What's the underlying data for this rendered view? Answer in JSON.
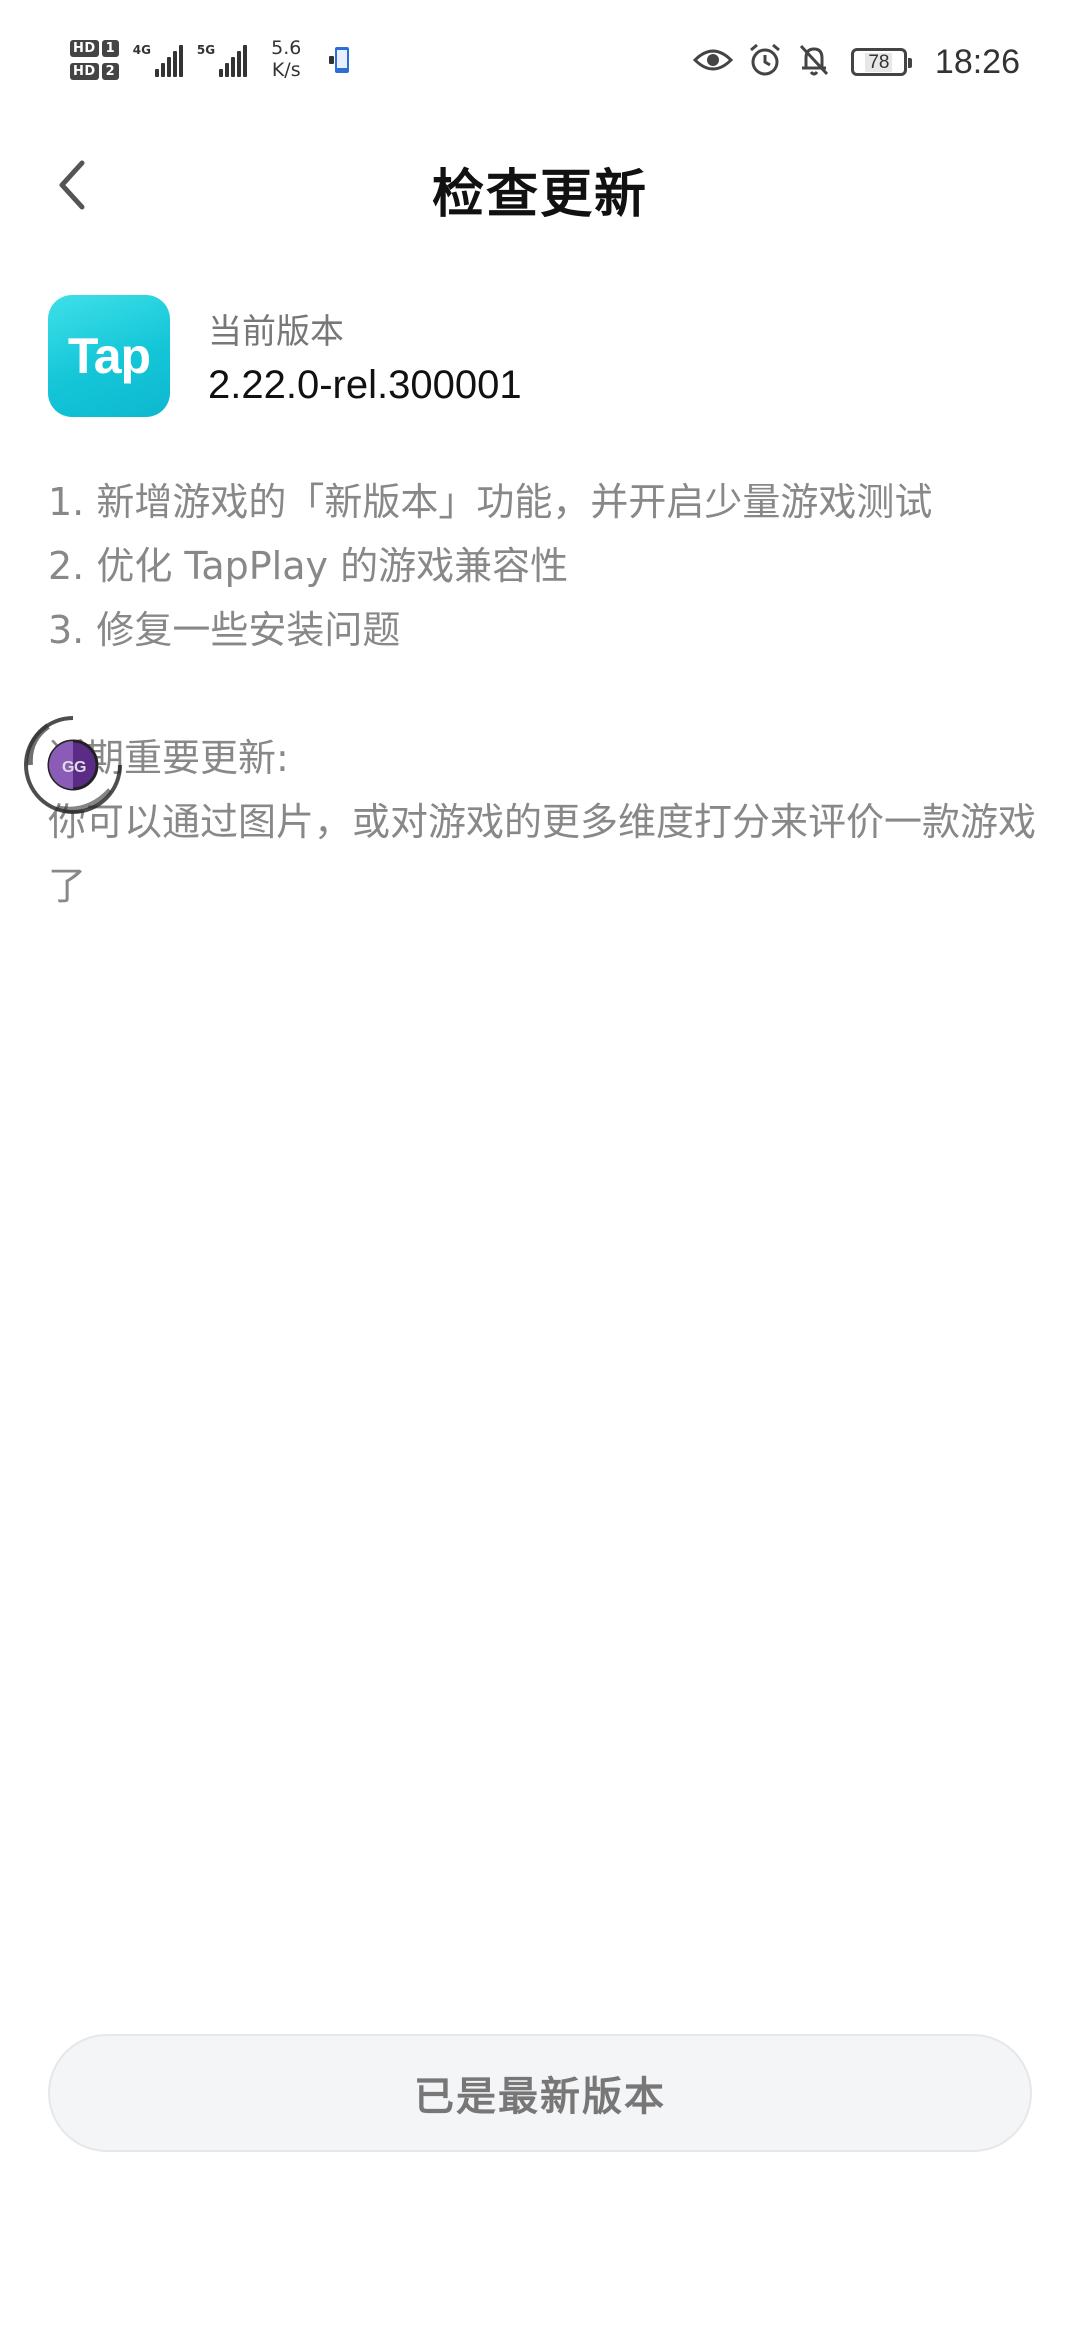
{
  "status_bar": {
    "hd1": "HD",
    "hd1_num": "1",
    "hd2": "HD",
    "hd2_num": "2",
    "net1": "4G",
    "net2": "5G",
    "speed_value": "5.6",
    "speed_unit": "K/s",
    "battery_level": "78",
    "time": "18:26"
  },
  "header": {
    "title": "检查更新",
    "back_icon": "chevron-left-icon"
  },
  "app": {
    "icon_text": "Tap",
    "icon_color": "#14c6d8",
    "version_label": "当前版本",
    "version_value": "2.22.0-rel.300001"
  },
  "notes": {
    "items": [
      "1. 新增游戏的「新版本」功能，并开启少量游戏测试",
      "2. 优化 TapPlay 的游戏兼容性",
      "3. 修复一些安装问题"
    ],
    "section_heading": "近期重要更新:",
    "section_body": "你可以通过图片，或对游戏的更多维度打分来评价一款游戏了"
  },
  "button": {
    "label": "已是最新版本"
  }
}
